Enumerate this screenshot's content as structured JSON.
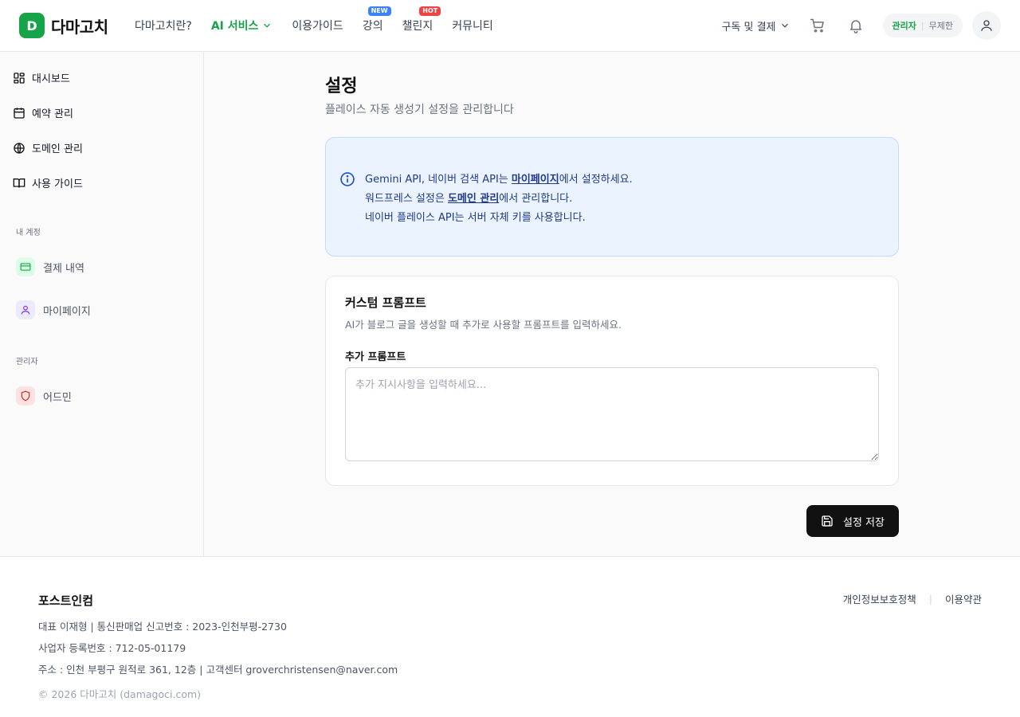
{
  "header": {
    "logo_mark": "D",
    "logo_text": "다마고치",
    "nav": [
      {
        "label": "다마고치란?"
      },
      {
        "label": "AI 서비스"
      },
      {
        "label": "이용가이드"
      },
      {
        "label": "강의",
        "badge": "NEW"
      },
      {
        "label": "챌린지",
        "badge": "HOT"
      },
      {
        "label": "커뮤니티"
      }
    ],
    "subscribe_label": "구독 및 결제",
    "role": "관리자",
    "plan": "무제한"
  },
  "sidebar": {
    "items": [
      {
        "label": "대시보드",
        "icon": "dashboard-icon"
      },
      {
        "label": "예약 관리",
        "icon": "calendar-icon"
      },
      {
        "label": "도메인 관리",
        "icon": "globe-icon"
      },
      {
        "label": "사용 가이드",
        "icon": "book-icon"
      }
    ],
    "section_account": "내 계정",
    "account_items": [
      {
        "label": "결제 내역",
        "icon": "credit-card-icon"
      },
      {
        "label": "마이페이지",
        "icon": "user-icon"
      }
    ],
    "section_admin": "관리자",
    "admin_items": [
      {
        "label": "어드민",
        "icon": "shield-icon"
      }
    ]
  },
  "main": {
    "title": "설정",
    "subtitle": "플레이스 자동 생성기 설정을 관리합니다",
    "info": {
      "line1_pre": "Gemini API, 네이버 검색 API는 ",
      "line1_link": "마이페이지",
      "line1_post": "에서 설정하세요.",
      "line2_pre": "워드프레스 설정은 ",
      "line2_link": "도메인 관리",
      "line2_post": "에서 관리합니다.",
      "line3": "네이버 플레이스 API는 서버 자체 키를 사용합니다."
    },
    "card": {
      "title": "커스텀 프롬프트",
      "description": "AI가 블로그 글을 생성할 때 추가로 사용할 프롬프트를 입력하세요.",
      "field_label": "추가 프롬프트",
      "placeholder": "추가 지시사항을 입력하세요...",
      "value": ""
    },
    "save_label": "설정 저장"
  },
  "footer": {
    "company": "포스트인컴",
    "line1": "대표 이재형 | 통신판매업 신고번호 : 2023-인천부평-2730",
    "line2": "사업자 등록번호 : 712-05-01179",
    "line3": "주소 : 인천 부평구 원적로 361, 12층 | 고객센터 groverchristensen@naver.com",
    "copyright": "© 2026 다마고치 (damagoci.com)",
    "privacy": "개인정보보호정책",
    "terms": "이용약관"
  },
  "colors": {
    "brand": "#16a34a",
    "info_bg": "#eaf3ff",
    "info_text": "#1e3a8a",
    "primary_button": "#111111"
  }
}
